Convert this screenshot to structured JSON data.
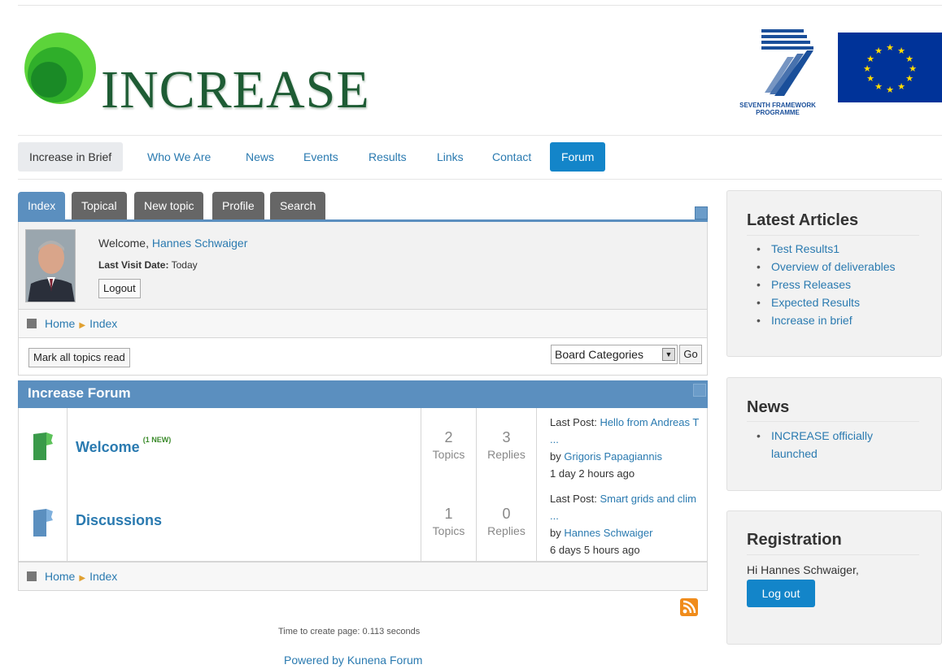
{
  "header": {
    "logo_text": "INCREASE",
    "fp7_label": "SEVENTH FRAMEWORK PROGRAMME"
  },
  "main_nav": [
    "Increase in Brief",
    "Who We Are",
    "News",
    "Events",
    "Results",
    "Links",
    "Contact",
    "Forum"
  ],
  "forum_tabs": [
    "Index",
    "Topical",
    "New topic",
    "Profile",
    "Search"
  ],
  "user": {
    "welcome_prefix": "Welcome,",
    "name": "Hannes Schwaiger",
    "last_visit_label": "Last Visit Date:",
    "last_visit_value": "Today",
    "logout_label": "Logout"
  },
  "breadcrumb": {
    "home": "Home",
    "current": "Index"
  },
  "actions": {
    "mark_read": "Mark all topics read",
    "board_select": "Board Categories",
    "go": "Go"
  },
  "category": {
    "title": "Increase Forum",
    "forums": [
      {
        "name": "Welcome",
        "new_tag": "(1 NEW)",
        "topics": "2",
        "topics_label": "Topics",
        "replies": "3",
        "replies_label": "Replies",
        "last_post_label": "Last Post:",
        "last_post_title": "Hello from Andreas T ...",
        "by_label": "by",
        "last_post_author": "Grigoris Papagiannis",
        "last_post_time": "1 day 2 hours ago",
        "folder_color": "#3a9a4a"
      },
      {
        "name": "Discussions",
        "new_tag": "",
        "topics": "1",
        "topics_label": "Topics",
        "replies": "0",
        "replies_label": "Replies",
        "last_post_label": "Last Post:",
        "last_post_title": "Smart grids and clim ...",
        "by_label": "by",
        "last_post_author": "Hannes Schwaiger",
        "last_post_time": "6 days 5 hours ago",
        "folder_color": "#5b8fbf"
      }
    ]
  },
  "footer": {
    "timing": "Time to create page: 0.113 seconds",
    "powered": "Powered by Kunena Forum"
  },
  "sidebar": {
    "latest": {
      "title": "Latest Articles",
      "items": [
        "Test Results1",
        "Overview of deliverables",
        "Press Releases",
        "Expected Results",
        "Increase in brief"
      ]
    },
    "news": {
      "title": "News",
      "items": [
        "INCREASE officially launched"
      ]
    },
    "registration": {
      "title": "Registration",
      "greeting": "Hi Hannes Schwaiger,",
      "logout": "Log out"
    }
  },
  "colors": {
    "forum_blue": "#5b8fbf",
    "nav_blue": "#1385c9",
    "link": "#2a7ab0",
    "logo_green": "#1e5c34",
    "eu_blue": "#003399",
    "eu_star": "#ffdd00"
  }
}
